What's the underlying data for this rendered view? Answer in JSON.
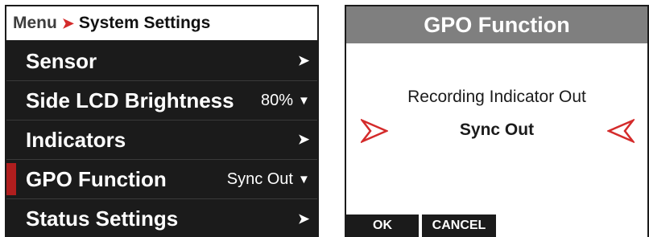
{
  "menu": {
    "breadcrumb": {
      "root": "Menu",
      "separator": "➤",
      "current": "System Settings"
    },
    "items": [
      {
        "label": "Sensor",
        "value": "",
        "chevron": "➤",
        "selected": false
      },
      {
        "label": "Side LCD Brightness",
        "value": "80%",
        "chevron": "▼",
        "selected": false
      },
      {
        "label": "Indicators",
        "value": "",
        "chevron": "➤",
        "selected": false
      },
      {
        "label": "GPO Function",
        "value": "Sync Out",
        "chevron": "▼",
        "selected": true
      },
      {
        "label": "Status Settings",
        "value": "",
        "chevron": "➤",
        "selected": false
      }
    ]
  },
  "dialog": {
    "title": "GPO Function",
    "options": {
      "previous": "Recording Indicator Out",
      "current": "Sync Out"
    },
    "softkeys": {
      "ok": "OK",
      "cancel": "CANCEL"
    }
  },
  "colors": {
    "accent_red": "#d42b2b",
    "selection_marker": "#b01e1e",
    "panel_bg": "#1b1b1b",
    "dialog_title_bg": "#7f7f7f"
  },
  "icons": {
    "breadcrumb_separator": "chevron-right-icon",
    "scroll_prev": "red-arrow-left-icon",
    "scroll_next": "red-arrow-right-icon"
  }
}
